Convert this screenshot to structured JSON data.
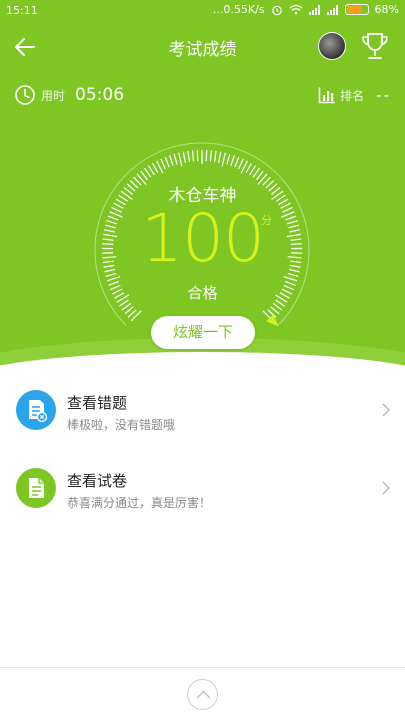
{
  "status_bar": {
    "time": "15:11",
    "network_speed": "...0.55K/s",
    "battery": "68%",
    "battery_level": 0.68
  },
  "nav": {
    "title": "考试成绩"
  },
  "info": {
    "time_label": "用时",
    "time_value": "05:06",
    "rank_label": "排名",
    "rank_value": "--"
  },
  "score": {
    "name": "木仓车神",
    "value": "100",
    "unit": "分",
    "result": "合格",
    "percent": 1.0,
    "share_label": "炫耀一下"
  },
  "list": [
    {
      "title": "查看错题",
      "subtitle": "棒极啦，没有错题哦",
      "icon": "wrong-questions-icon"
    },
    {
      "title": "查看试卷",
      "subtitle": "恭喜满分通过，真是厉害！",
      "icon": "exam-paper-icon"
    }
  ],
  "colors": {
    "primary_green": "#7dc623",
    "score_yellow": "#d6f21c",
    "blue_icon": "#2aa4ea",
    "green_icon": "#7dc623",
    "battery_orange": "#f7a11a"
  }
}
